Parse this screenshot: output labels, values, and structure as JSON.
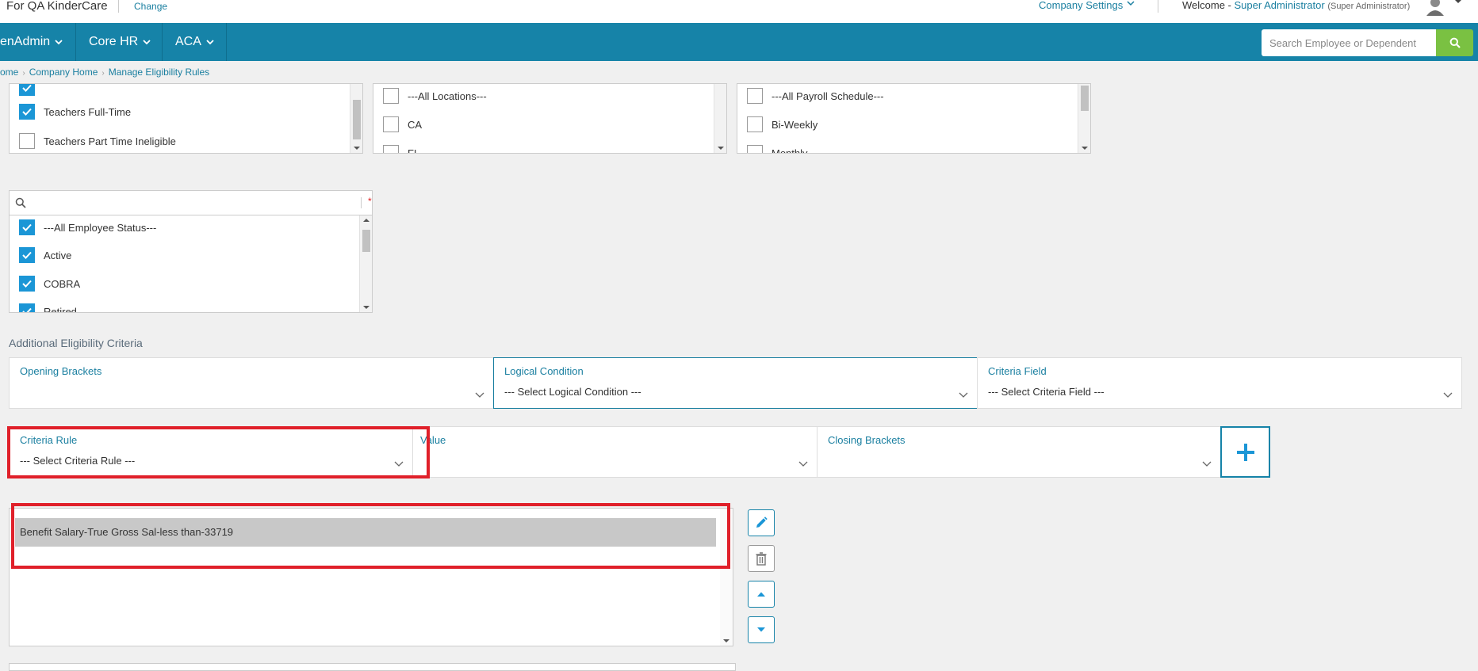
{
  "topbar": {
    "company_name": "For QA KinderCare",
    "change_link": "Change",
    "company_settings": "Company Settings",
    "welcome_label": "Welcome -",
    "user_name": "Super Administrator",
    "user_role": "(Super Administrator)"
  },
  "nav": {
    "items": [
      {
        "label": "enAdmin"
      },
      {
        "label": "Core HR"
      },
      {
        "label": "ACA"
      }
    ],
    "search_placeholder": "Search Employee or Dependent"
  },
  "breadcrumb": [
    "ome",
    "Company Home",
    "Manage Eligibility Rules"
  ],
  "group_list": {
    "items": [
      {
        "label": "",
        "checked": true
      },
      {
        "label": "Teachers Full-Time",
        "checked": true
      },
      {
        "label": "Teachers Part Time Ineligible",
        "checked": false
      }
    ]
  },
  "location_list": {
    "items": [
      {
        "label": "---All Locations---",
        "checked": false
      },
      {
        "label": "CA",
        "checked": false
      },
      {
        "label": "FL",
        "checked": false
      }
    ]
  },
  "payroll_list": {
    "items": [
      {
        "label": "---All Payroll Schedule---",
        "checked": false
      },
      {
        "label": "Bi-Weekly",
        "checked": false
      },
      {
        "label": "Monthly",
        "checked": false
      }
    ]
  },
  "status_list": {
    "search_value": "",
    "required_marker": "*",
    "items": [
      {
        "label": "---All Employee Status---",
        "checked": true
      },
      {
        "label": "Active",
        "checked": true
      },
      {
        "label": "COBRA",
        "checked": true
      },
      {
        "label": "Retired",
        "checked": true
      }
    ]
  },
  "criteria": {
    "section_title": "Additional Eligibility Criteria",
    "opening_brackets": {
      "label": "Opening Brackets",
      "value": ""
    },
    "logical_condition": {
      "label": "Logical Condition",
      "value": "--- Select Logical Condition ---"
    },
    "criteria_field": {
      "label": "Criteria Field",
      "value": "--- Select Criteria Field ---"
    },
    "criteria_rule": {
      "label": "Criteria Rule",
      "value": "--- Select Criteria Rule ---"
    },
    "value_field": {
      "label": "Value",
      "value": ""
    },
    "closing_brackets": {
      "label": "Closing Brackets",
      "value": ""
    }
  },
  "rules": {
    "items": [
      "Benefit Salary-True Gross Sal-less than-33719"
    ]
  },
  "colors": {
    "nav_bg": "#1683a8",
    "accent": "#1a7fa0",
    "checkbox_on": "#1b96d6",
    "search_button": "#7ac142",
    "highlight_box": "#e0202a"
  }
}
